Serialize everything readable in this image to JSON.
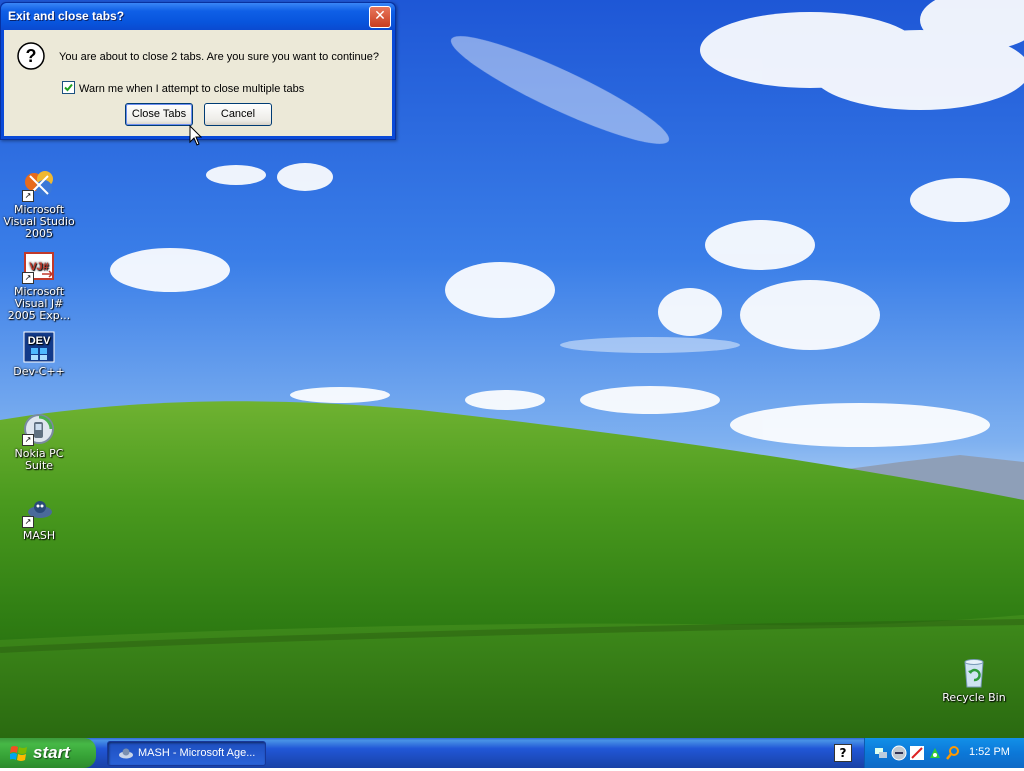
{
  "dialog": {
    "title": "Exit and close tabs?",
    "message": "You are about to close 2 tabs. Are you sure you want to continue?",
    "checkbox_label": "Warn me when I attempt to close multiple tabs",
    "checkbox_checked": true,
    "close_tabs_label": "Close Tabs",
    "cancel_label": "Cancel",
    "close_glyph": "✕",
    "icon": "question-icon"
  },
  "desktop": {
    "icons": [
      {
        "label": "Microsoft Visual Studio 2005",
        "icon": "visual-studio-icon"
      },
      {
        "label": "Microsoft Visual J# 2005 Exp...",
        "icon": "visual-jsharp-icon",
        "badge": "VJ#"
      },
      {
        "label": "Dev-C++",
        "icon": "dev-cpp-icon",
        "badge": "DEV"
      },
      {
        "label": "Nokia PC Suite",
        "icon": "nokia-pc-suite-icon"
      },
      {
        "label": "MASH",
        "icon": "mash-icon"
      }
    ],
    "recycle_bin": {
      "label": "Recycle Bin",
      "icon": "recycle-bin-icon"
    }
  },
  "taskbar": {
    "start_label": "start",
    "tasks": [
      {
        "label": "MASH - Microsoft Age...",
        "icon": "mash-icon"
      }
    ],
    "help_glyph": "?",
    "tray_icons": [
      "network-icon",
      "sound-icon",
      "security-icon",
      "update-icon",
      "search-icon"
    ],
    "clock": "1:52 PM"
  },
  "colors": {
    "titlebar": "#0855dd",
    "dialog_body": "#ece9d8",
    "taskbar": "#2157d7",
    "start_button": "#37a337",
    "tray": "#0c78d8"
  }
}
